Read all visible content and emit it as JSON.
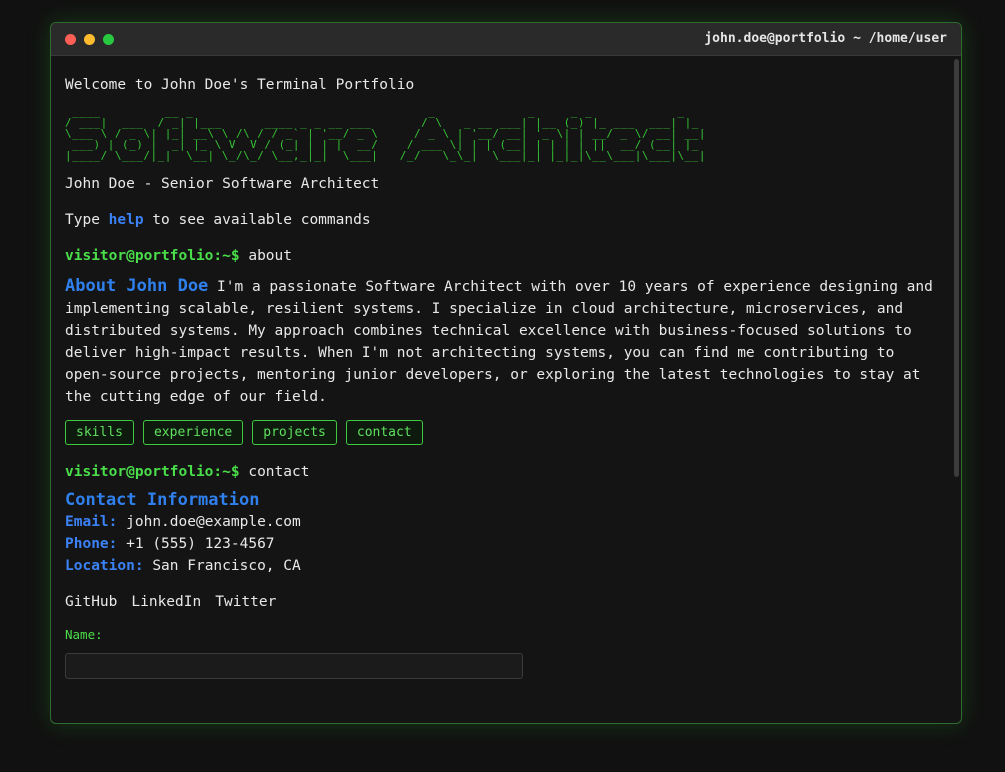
{
  "window": {
    "title": "john.doe@portfolio ~ /home/user",
    "scrollbar_thumb_fraction": 0.6
  },
  "welcome": "Welcome to John Doe's Terminal Portfolio",
  "ascii_banner_text": "SoftwareArchitect",
  "subtitle": "John Doe - Senior Software Architect",
  "hint": {
    "prefix": "Type ",
    "command": "help",
    "suffix": " to see available commands"
  },
  "prompt": "visitor@portfolio:~$",
  "about": {
    "command": "about",
    "heading": "About John Doe",
    "text": "I'm a passionate Software Architect with over 10 years of experience designing and implementing scalable, resilient systems. I specialize in cloud architecture, microservices, and distributed systems. My approach combines technical excellence with business-focused solutions to deliver high-impact results. When I'm not architecting systems, you can find me contributing to open-source projects, mentoring junior developers, or exploring the latest technologies to stay at the cutting edge of our field."
  },
  "quick_buttons": [
    "skills",
    "experience",
    "projects",
    "contact"
  ],
  "contact": {
    "command": "contact",
    "heading": "Contact Information",
    "email_label": "Email:",
    "email": "john.doe@example.com",
    "phone_label": "Phone:",
    "phone": "+1 (555) 123-4567",
    "location_label": "Location:",
    "location": "San Francisco, CA",
    "links": [
      "GitHub",
      "LinkedIn",
      "Twitter"
    ],
    "form_name_label": "Name:"
  },
  "colors": {
    "accent_green": "#4ade4a",
    "accent_blue": "#3b82f6",
    "background": "#141414"
  }
}
